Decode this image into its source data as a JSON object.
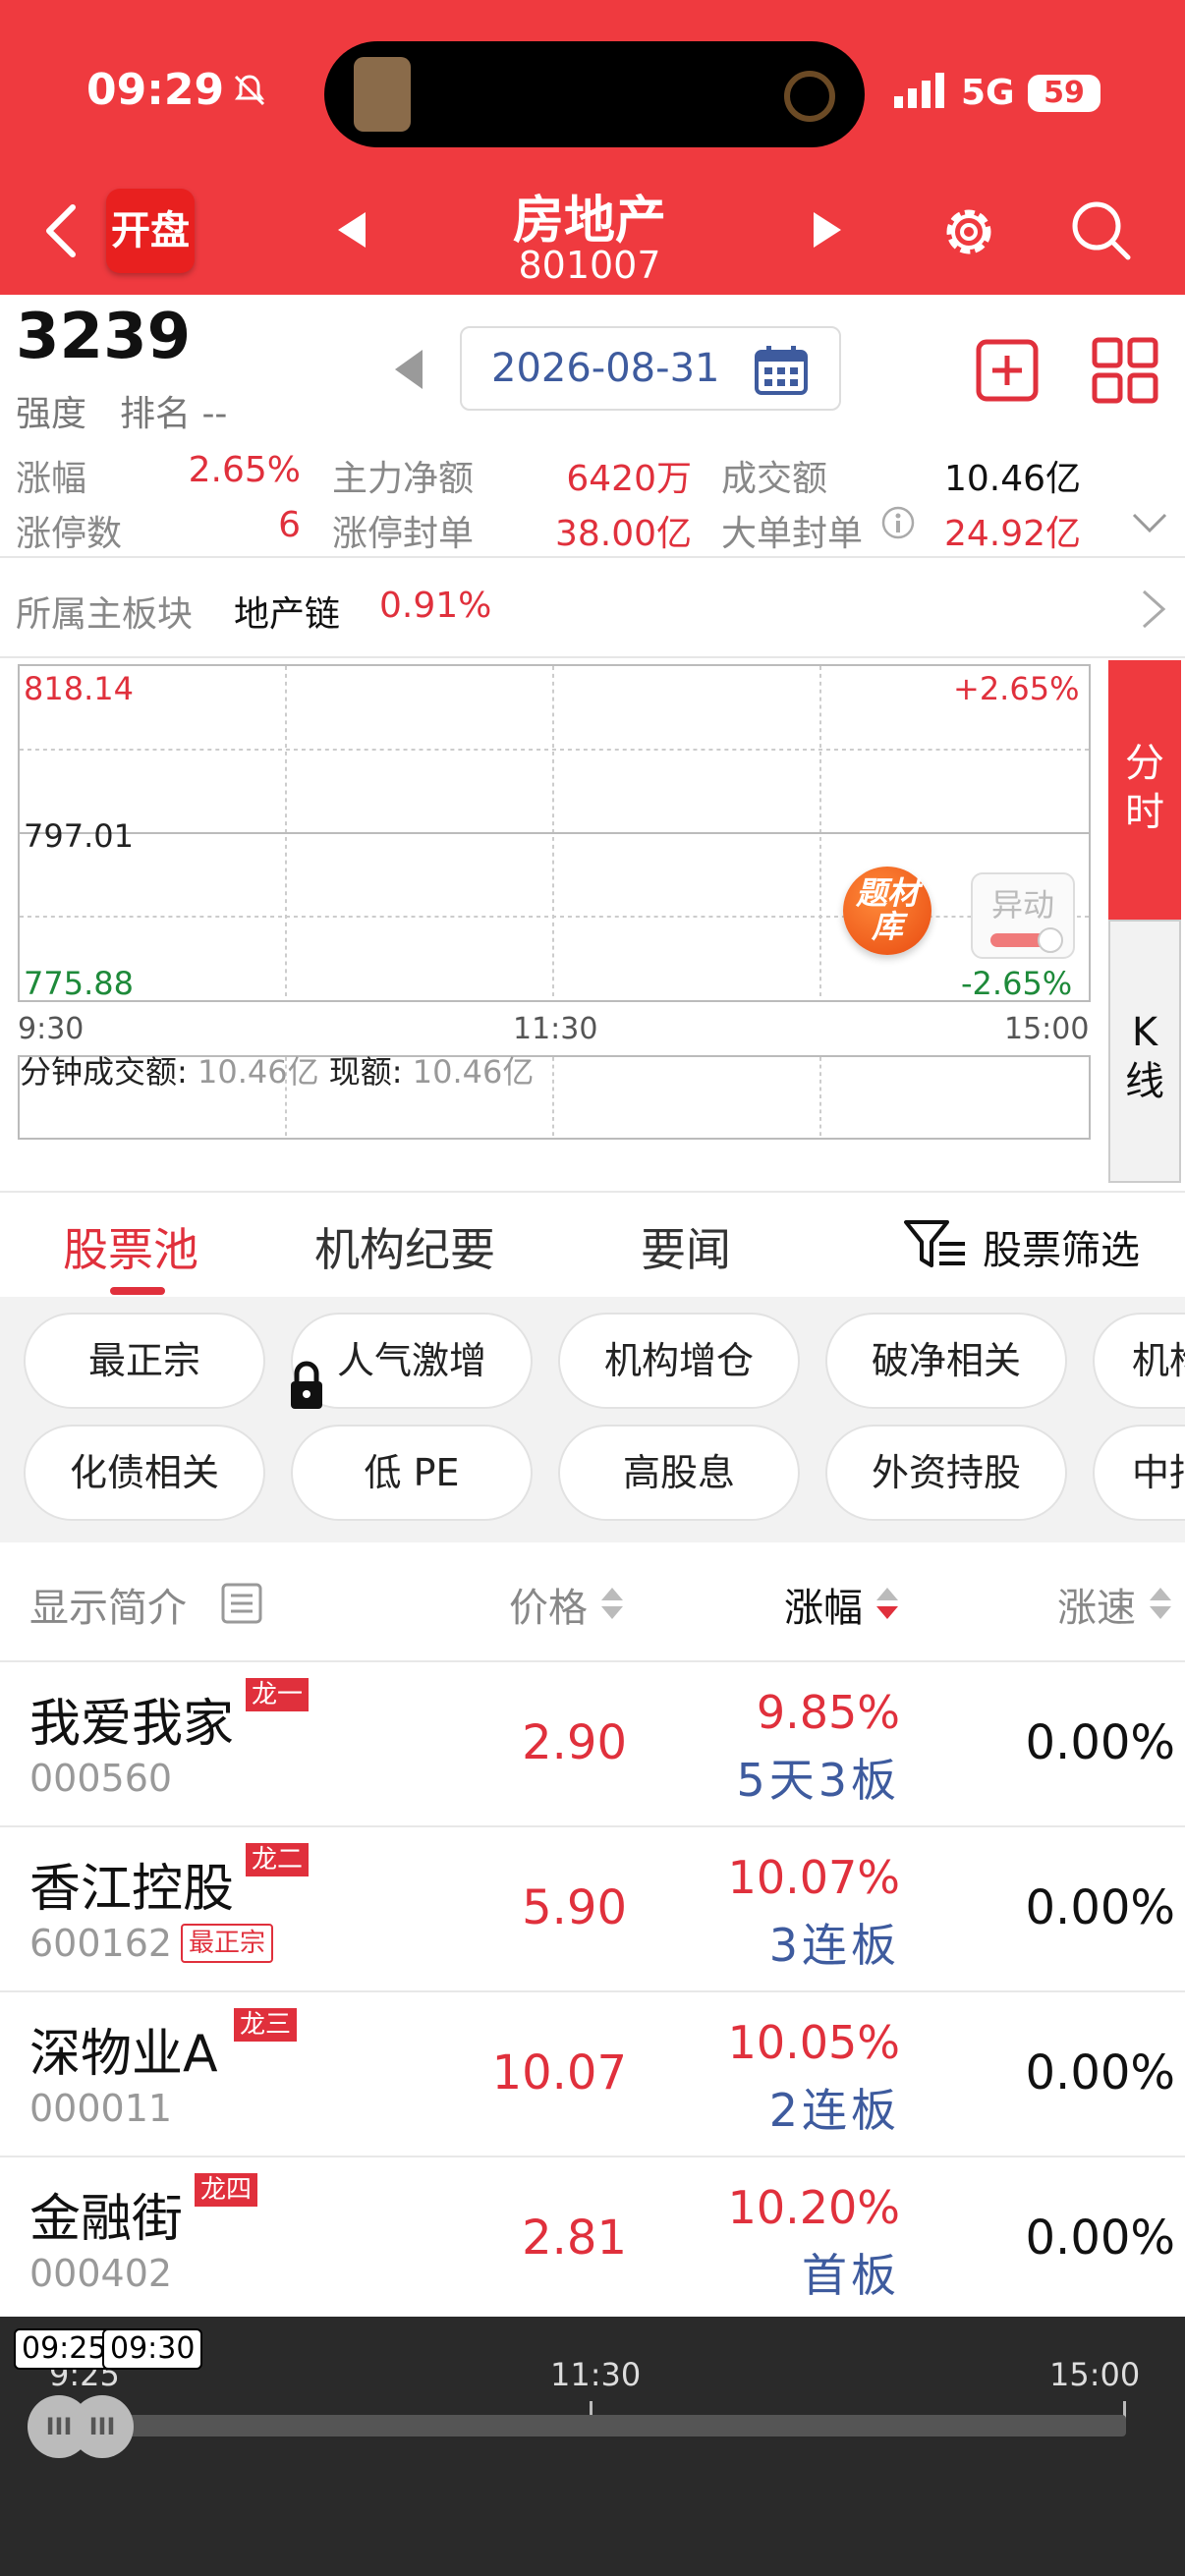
{
  "status_bar": {
    "time": "09:29",
    "network": "5G",
    "battery": "59"
  },
  "header": {
    "kaipan_label": "开盘",
    "title": "房地产",
    "code": "801007"
  },
  "info": {
    "strength_value": "3239",
    "strength_label": "强度",
    "rank_label": "排名 --",
    "date": "2026-08-31"
  },
  "stats": [
    {
      "label": "涨幅",
      "value": "2.65%"
    },
    {
      "label": "主力净额",
      "value": "6420万"
    },
    {
      "label": "成交额",
      "value": "10.46亿"
    },
    {
      "label": "涨停数",
      "value": "6"
    },
    {
      "label": "涨停封单",
      "value": "38.00亿"
    },
    {
      "label": "大单封单",
      "value": "24.92亿"
    }
  ],
  "main_board": {
    "label": "所属主板块",
    "name": "地产链",
    "pct": "0.91%"
  },
  "chart": {
    "high_price": "818.14",
    "mid_price": "797.01",
    "low_price": "775.88",
    "high_pct": "+2.65%",
    "low_pct": "-2.65%",
    "time_start": "9:30",
    "time_mid": "11:30",
    "time_end": "15:00",
    "minute_vol_label": "分钟成交额:",
    "minute_vol_value": "10.46亿",
    "now_vol_label": "现额:",
    "now_vol_value": "10.46亿",
    "ticai_badge": "题材库",
    "yidong_badge": "异动",
    "side_tab_fenshi": "分时",
    "side_tab_kxian": "K线",
    "colors": {
      "up": "#e0303c",
      "down": "#1e8a3a",
      "accent": "#ef3a3f"
    }
  },
  "tabs": [
    "股票池",
    "机构纪要",
    "要闻"
  ],
  "filter_label": "股票筛选",
  "chips_row1": [
    "最正宗",
    "人气激增",
    "机构增仓",
    "破净相关",
    "机构"
  ],
  "chips_row2": [
    "化债相关",
    "低 PE",
    "高股息",
    "外资持股",
    "中报"
  ],
  "table": {
    "headers": {
      "name": "显示简介",
      "price": "价格",
      "change": "涨幅",
      "speed": "涨速"
    },
    "rows": [
      {
        "name": "我爱我家",
        "code": "000560",
        "tag": "龙一",
        "tag2": "",
        "price": "2.90",
        "change": "9.85%",
        "note": "5天3板",
        "speed": "0.00%"
      },
      {
        "name": "香江控股",
        "code": "600162",
        "tag": "龙二",
        "tag2": "最正宗",
        "price": "5.90",
        "change": "10.07%",
        "note": "3连板",
        "speed": "0.00%"
      },
      {
        "name": "深物业A",
        "code": "000011",
        "tag": "龙三",
        "tag2": "",
        "price": "10.07",
        "change": "10.05%",
        "note": "2连板",
        "speed": "0.00%"
      },
      {
        "name": "金融街",
        "code": "000402",
        "tag": "龙四",
        "tag2": "",
        "price": "2.81",
        "change": "10.20%",
        "note": "首板",
        "speed": "0.00%"
      }
    ]
  },
  "timeline": {
    "label_start": "9:25",
    "bubble_start": "09:25",
    "bubble_end": "09:30",
    "label_mid": "11:30",
    "label_end": "15:00",
    "handle_glyph": "III"
  }
}
